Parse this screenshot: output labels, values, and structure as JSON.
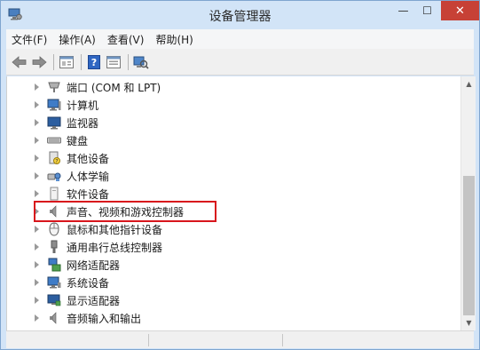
{
  "window": {
    "title": "设备管理器",
    "controls": {
      "minimize": "—",
      "maximize": "☐",
      "close": "✕"
    }
  },
  "menubar": {
    "items": [
      {
        "label": "文件(F)"
      },
      {
        "label": "操作(A)"
      },
      {
        "label": "查看(V)"
      },
      {
        "label": "帮助(H)"
      }
    ]
  },
  "toolbar": {
    "buttons": [
      "back-arrow-icon",
      "forward-arrow-icon",
      "properties-icon",
      "help-icon",
      "view-icon",
      "scan-hardware-icon"
    ]
  },
  "tree": {
    "items": [
      {
        "label": "端口 (COM 和 LPT)",
        "icon": "port-icon"
      },
      {
        "label": "计算机",
        "icon": "computer-icon"
      },
      {
        "label": "监视器",
        "icon": "monitor-icon"
      },
      {
        "label": "键盘",
        "icon": "keyboard-icon"
      },
      {
        "label": "其他设备",
        "icon": "other-device-icon"
      },
      {
        "label": "人体学输",
        "icon": "hid-icon"
      },
      {
        "label": "软件设备",
        "icon": "software-device-icon"
      },
      {
        "label": "声音、视频和游戏控制器",
        "icon": "speaker-icon",
        "highlighted": true
      },
      {
        "label": "鼠标和其他指针设备",
        "icon": "mouse-icon"
      },
      {
        "label": "通用串行总线控制器",
        "icon": "usb-icon"
      },
      {
        "label": "网络适配器",
        "icon": "network-icon"
      },
      {
        "label": "系统设备",
        "icon": "system-device-icon"
      },
      {
        "label": "显示适配器",
        "icon": "display-adapter-icon"
      },
      {
        "label": "音频输入和输出",
        "icon": "audio-io-icon"
      }
    ]
  },
  "colors": {
    "frame": "#d2e4f7",
    "close_button": "#c74136",
    "highlight_border": "#d8161c",
    "scroll_thumb": "#c4c4c4"
  }
}
